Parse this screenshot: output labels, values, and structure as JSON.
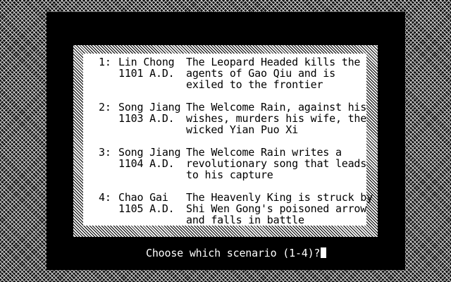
{
  "scenarios": [
    {
      "number": "1:",
      "name": "Lin Chong",
      "year": "1101 A.D.",
      "desc": [
        "The Leopard Headed kills the",
        "agents of Gao Qiu and is",
        "exiled to the frontier"
      ]
    },
    {
      "number": "2:",
      "name": "Song Jiang",
      "year": "1103 A.D.",
      "desc": [
        "The Welcome Rain, against his",
        "wishes, murders his wife, the",
        "wicked Yian Puo Xi"
      ]
    },
    {
      "number": "3:",
      "name": "Song Jiang",
      "year": "1104 A.D.",
      "desc": [
        "The Welcome Rain writes a",
        "revolutionary song that leads",
        "to his capture"
      ]
    },
    {
      "number": "4:",
      "name": "Chao Gai",
      "year": "1105 A.D.",
      "desc": [
        "The Heavenly King is struck by",
        "Shi Wen Gong's poisoned arrow",
        "and falls in battle"
      ]
    }
  ],
  "prompt": "Choose which scenario (1-4)?"
}
